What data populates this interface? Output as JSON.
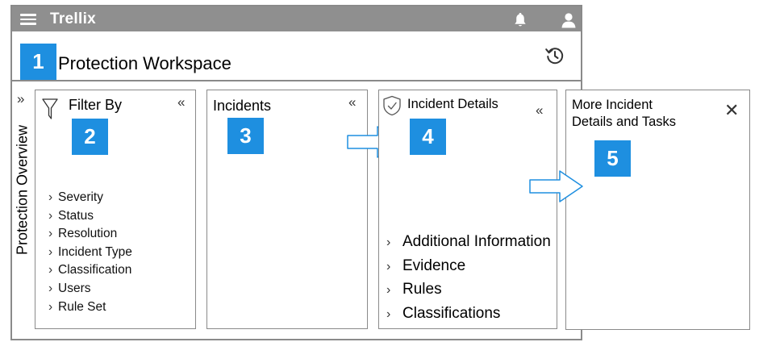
{
  "app": {
    "brand": "Trellix"
  },
  "header": {
    "badge": "1",
    "title": "Protection Workspace"
  },
  "side_rail": {
    "label": "Protection Overview",
    "expand_glyph": "»"
  },
  "filter_panel": {
    "title": "Filter By",
    "badge": "2",
    "collapse_glyph": "«",
    "items": [
      {
        "label": "Severity"
      },
      {
        "label": "Status"
      },
      {
        "label": "Resolution"
      },
      {
        "label": "Incident Type"
      },
      {
        "label": "Classification"
      },
      {
        "label": "Users"
      },
      {
        "label": "Rule Set"
      }
    ]
  },
  "incidents_panel": {
    "title": "Incidents",
    "badge": "3",
    "collapse_glyph": "«"
  },
  "details_panel": {
    "title": "Incident Details",
    "badge": "4",
    "collapse_glyph": "«",
    "items": [
      {
        "label": "Additional Information"
      },
      {
        "label": "Evidence"
      },
      {
        "label": "Rules"
      },
      {
        "label": "Classifications"
      }
    ]
  },
  "tasks_panel": {
    "title_line1": "More Incident",
    "title_line2": "Details and Tasks",
    "badge": "5",
    "close_glyph": "✕"
  },
  "colors": {
    "accent": "#1e8fe0",
    "topbar": "#8f8f8f",
    "border": "#8a8a8a"
  },
  "icons": [
    "menu-icon",
    "bell-icon",
    "user-icon",
    "history-icon",
    "funnel-icon",
    "shield-icon",
    "close-icon",
    "arrow-right-icon"
  ]
}
